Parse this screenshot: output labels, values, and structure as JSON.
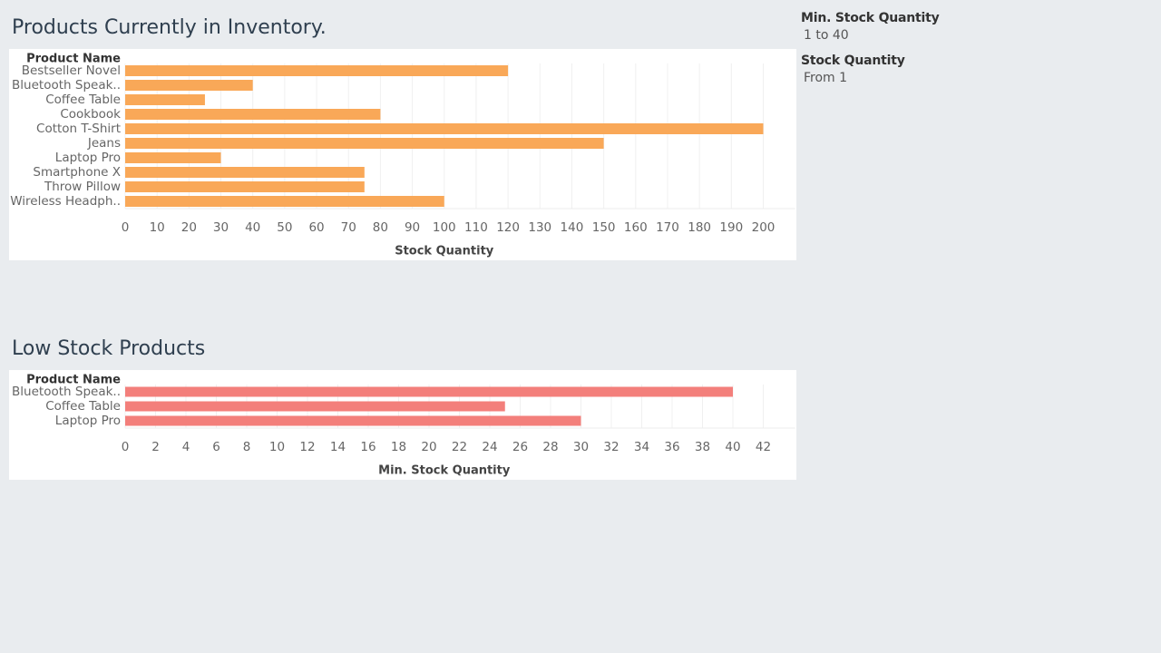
{
  "dashboard": {
    "filters": [
      {
        "title": "Min. Stock Quantity",
        "value": "1 to 40"
      },
      {
        "title": "Stock Quantity",
        "value": "From 1"
      }
    ]
  },
  "chart_data": [
    {
      "type": "bar",
      "orientation": "horizontal",
      "title": "Products Currently in Inventory.",
      "row_header": "Product Name",
      "categories": [
        "Bestseller Novel",
        "Bluetooth Speak..",
        "Coffee Table",
        "Cookbook",
        "Cotton T-Shirt",
        "Jeans",
        "Laptop Pro",
        "Smartphone X",
        "Throw Pillow",
        "Wireless Headph.."
      ],
      "values": [
        120,
        40,
        25,
        80,
        200,
        150,
        30,
        75,
        75,
        100
      ],
      "xlabel": "Stock Quantity",
      "xlim": [
        0,
        200
      ],
      "ticks": [
        0,
        10,
        20,
        30,
        40,
        50,
        60,
        70,
        80,
        90,
        100,
        110,
        120,
        130,
        140,
        150,
        160,
        170,
        180,
        190,
        200
      ],
      "grid": true,
      "color": "#f9a858"
    },
    {
      "type": "bar",
      "orientation": "horizontal",
      "title": "Low Stock Products",
      "row_header": "Product Name",
      "categories": [
        "Bluetooth Speak..",
        "Coffee Table",
        "Laptop Pro"
      ],
      "values": [
        40,
        25,
        30
      ],
      "xlabel": "Min. Stock Quantity",
      "xlim": [
        0,
        42
      ],
      "ticks": [
        0,
        2,
        4,
        6,
        8,
        10,
        12,
        14,
        16,
        18,
        20,
        22,
        24,
        26,
        28,
        30,
        32,
        34,
        36,
        38,
        40,
        42
      ],
      "grid": true,
      "color": "#f37f7b"
    }
  ]
}
